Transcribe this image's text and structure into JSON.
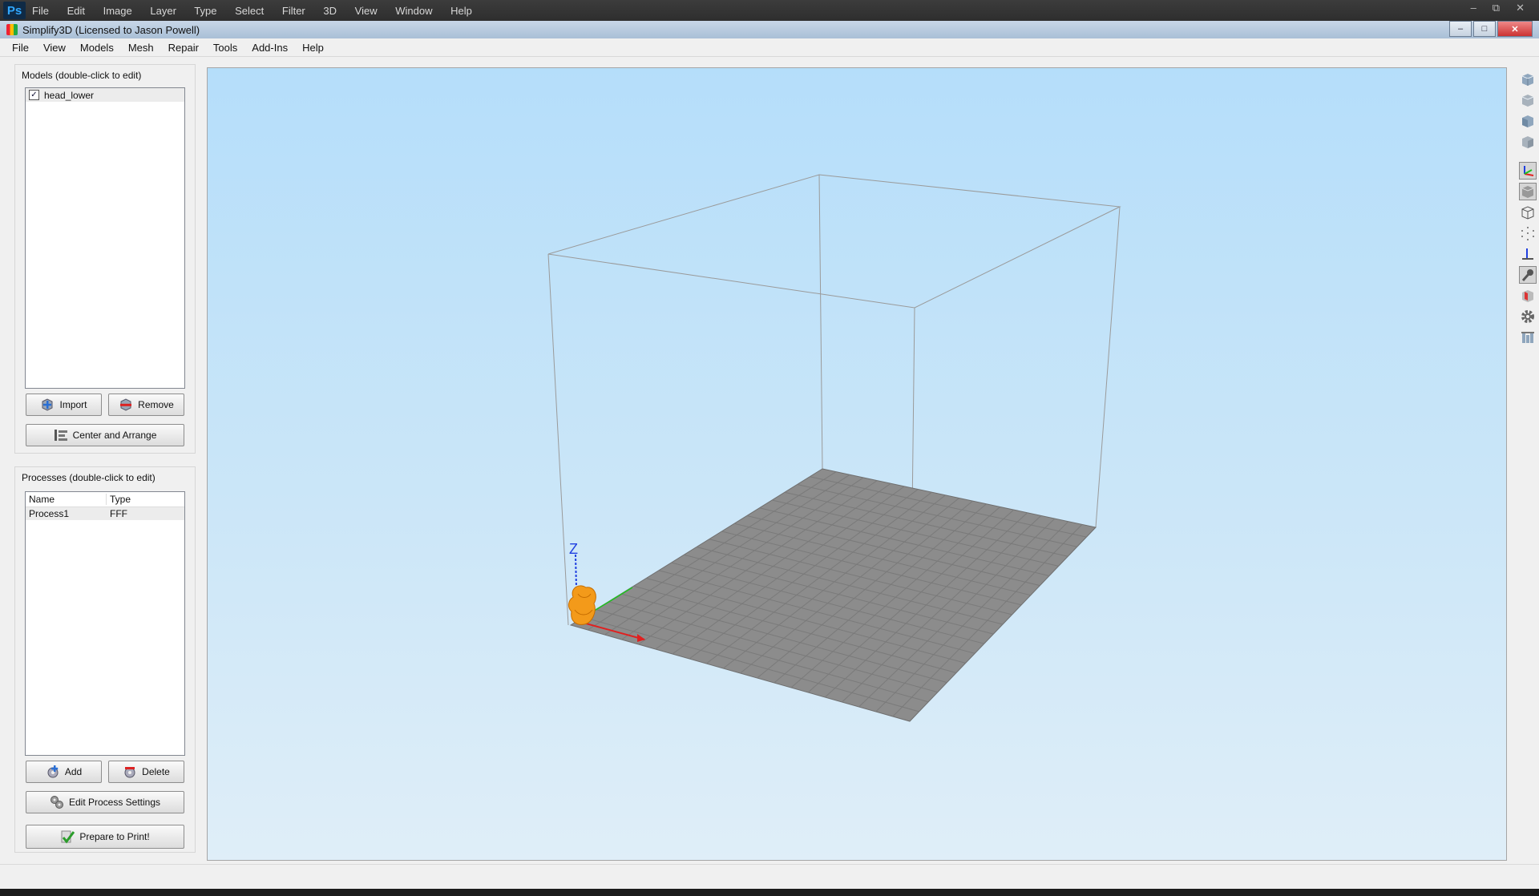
{
  "host": {
    "logo": "Ps",
    "menu": [
      "File",
      "Edit",
      "Image",
      "Layer",
      "Type",
      "Select",
      "Filter",
      "3D",
      "View",
      "Window",
      "Help"
    ],
    "controls": [
      "–",
      "⧉",
      "✕"
    ]
  },
  "window": {
    "title": "Simplify3D (Licensed to Jason Powell)",
    "controls": [
      "–",
      "□",
      "✕"
    ]
  },
  "menu": [
    "File",
    "View",
    "Models",
    "Mesh",
    "Repair",
    "Tools",
    "Add-Ins",
    "Help"
  ],
  "models_panel": {
    "title": "Models (double-click to edit)",
    "items": [
      {
        "label": "head_lower",
        "checked": true
      }
    ],
    "import_label": "Import",
    "remove_label": "Remove",
    "center_label": "Center and Arrange"
  },
  "processes_panel": {
    "title": "Processes (double-click to edit)",
    "columns": [
      "Name",
      "Type"
    ],
    "rows": [
      {
        "name": "Process1",
        "type": "FFF"
      }
    ],
    "add_label": "Add",
    "delete_label": "Delete",
    "edit_label": "Edit Process Settings",
    "prepare_label": "Prepare to Print!"
  },
  "viewport": {
    "axis_z_label": "Z",
    "axis_colors": {
      "x": "#e02020",
      "y": "#20c020",
      "z": "#2040e0"
    },
    "model_color": "#f39a1a",
    "bed_color": "#8a8a8a"
  },
  "right_toolbar": [
    "front-view-icon",
    "back-view-icon",
    "left-view-icon",
    "right-view-icon",
    "axes-icon",
    "solid-cube-icon",
    "wireframe-icon",
    "points-icon",
    "origin-icon",
    "key-icon",
    "cross-section-icon",
    "settings-gear-icon",
    "print-bed-icon"
  ]
}
